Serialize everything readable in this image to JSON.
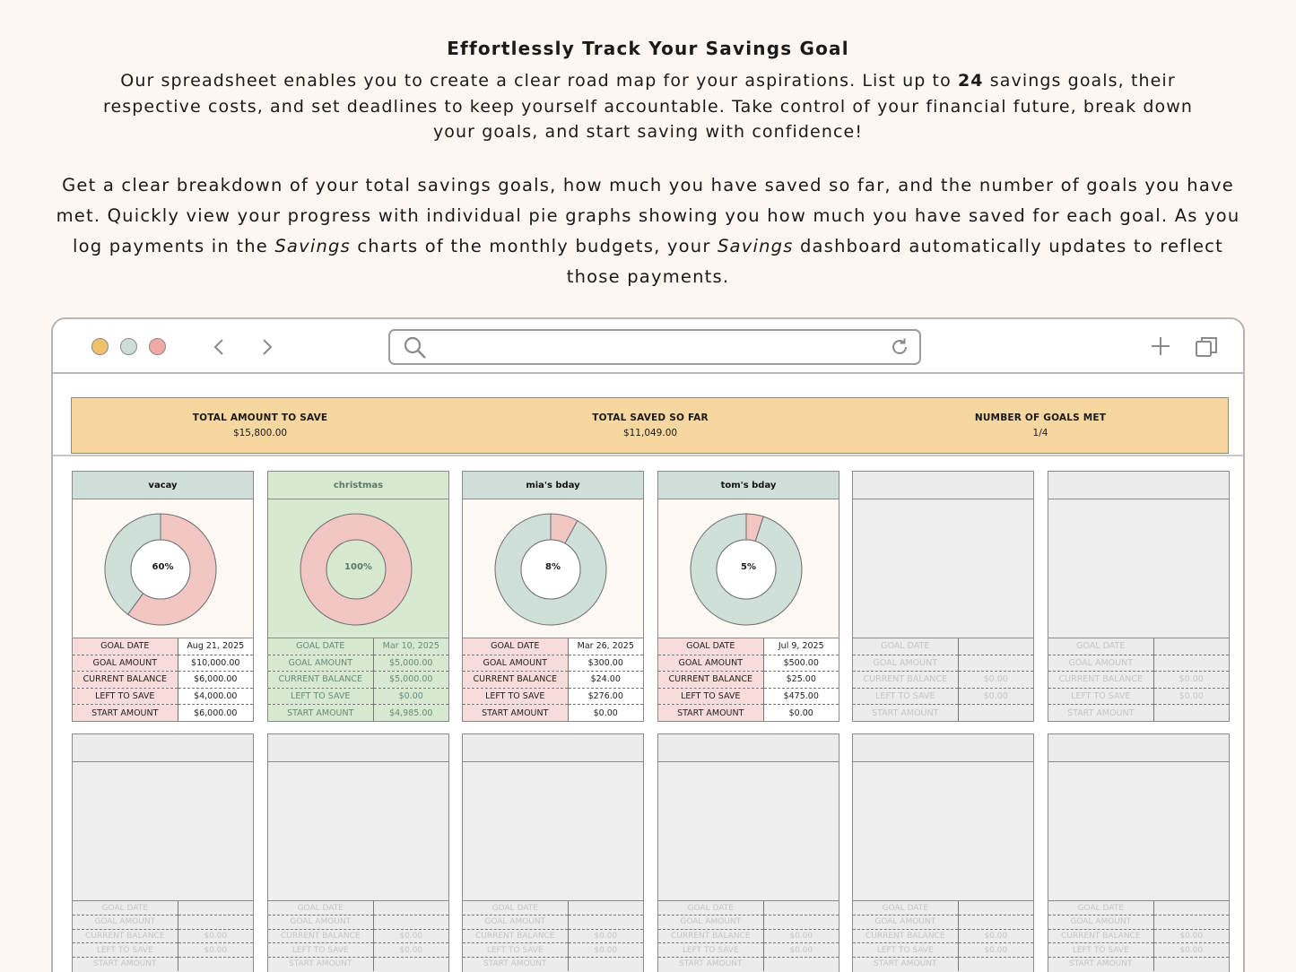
{
  "header": {
    "title": "Effortlessly Track Your Savings Goal",
    "p1_before": "Our spreadsheet enables you to create a clear road map for your aspirations. List up to ",
    "p1_bold": "24",
    "p1_after": " savings goals, their respective costs, and set deadlines to keep yourself accountable.  Take control of your financial future, break down your goals, and start saving with confidence!",
    "p2_a": "Get a clear breakdown of your total savings goals, how much you have saved so far, and the number of goals you have met. Quickly view your progress with individual pie graphs showing you how much you have saved for each goal. As you log payments in the ",
    "p2_i1": "Savings",
    "p2_b": " charts of the monthly budgets, your ",
    "p2_i2": "Savings",
    "p2_c": " dashboard automatically updates to reflect those payments."
  },
  "browser": {
    "url_value": "",
    "icons": [
      "back-icon",
      "forward-icon",
      "search-icon",
      "reload-icon",
      "plus-icon",
      "tabs-icon"
    ]
  },
  "summary": {
    "total_label": "TOTAL AMOUNT TO SAVE",
    "total_value": "$15,800.00",
    "saved_label": "TOTAL SAVED SO FAR",
    "saved_value": "$11,049.00",
    "met_label": "NUMBER OF GOALS MET",
    "met_value": "1/4"
  },
  "labels": {
    "goal_date": "GOAL DATE",
    "goal_amount": "GOAL AMOUNT",
    "current_balance": "CURRENT BALANCE",
    "left_to_save": "LEFT TO SAVE",
    "start_amount": "START AMOUNT",
    "empty_zero": "$0.00"
  },
  "colors": {
    "saved_pink": "#f2c6c3",
    "remaining_green": "#cfdfda",
    "summary_bg": "#f6d7a0",
    "met_bg": "#d8e9d2"
  },
  "goals": [
    {
      "name": "vacay",
      "percent_label": "60%",
      "progress": 0.6,
      "goal_date": "Aug 21, 2025",
      "goal_amount": "$10,000.00",
      "current_balance": "$6,000.00",
      "left_to_save": "$4,000.00",
      "start_amount": "$6,000.00"
    },
    {
      "name": "christmas",
      "percent_label": "100%",
      "progress": 1.0,
      "goal_date": "Mar 10, 2025",
      "goal_amount": "$5,000.00",
      "current_balance": "$5,000.00",
      "left_to_save": "$0.00",
      "start_amount": "$4,985.00"
    },
    {
      "name": "mia's bday",
      "percent_label": "8%",
      "progress": 0.08,
      "goal_date": "Mar 26, 2025",
      "goal_amount": "$300.00",
      "current_balance": "$24.00",
      "left_to_save": "$276.00",
      "start_amount": "$0.00"
    },
    {
      "name": "tom's bday",
      "percent_label": "5%",
      "progress": 0.05,
      "goal_date": "Jul 9, 2025",
      "goal_amount": "$500.00",
      "current_balance": "$25.00",
      "left_to_save": "$475.00",
      "start_amount": "$0.00"
    }
  ]
}
